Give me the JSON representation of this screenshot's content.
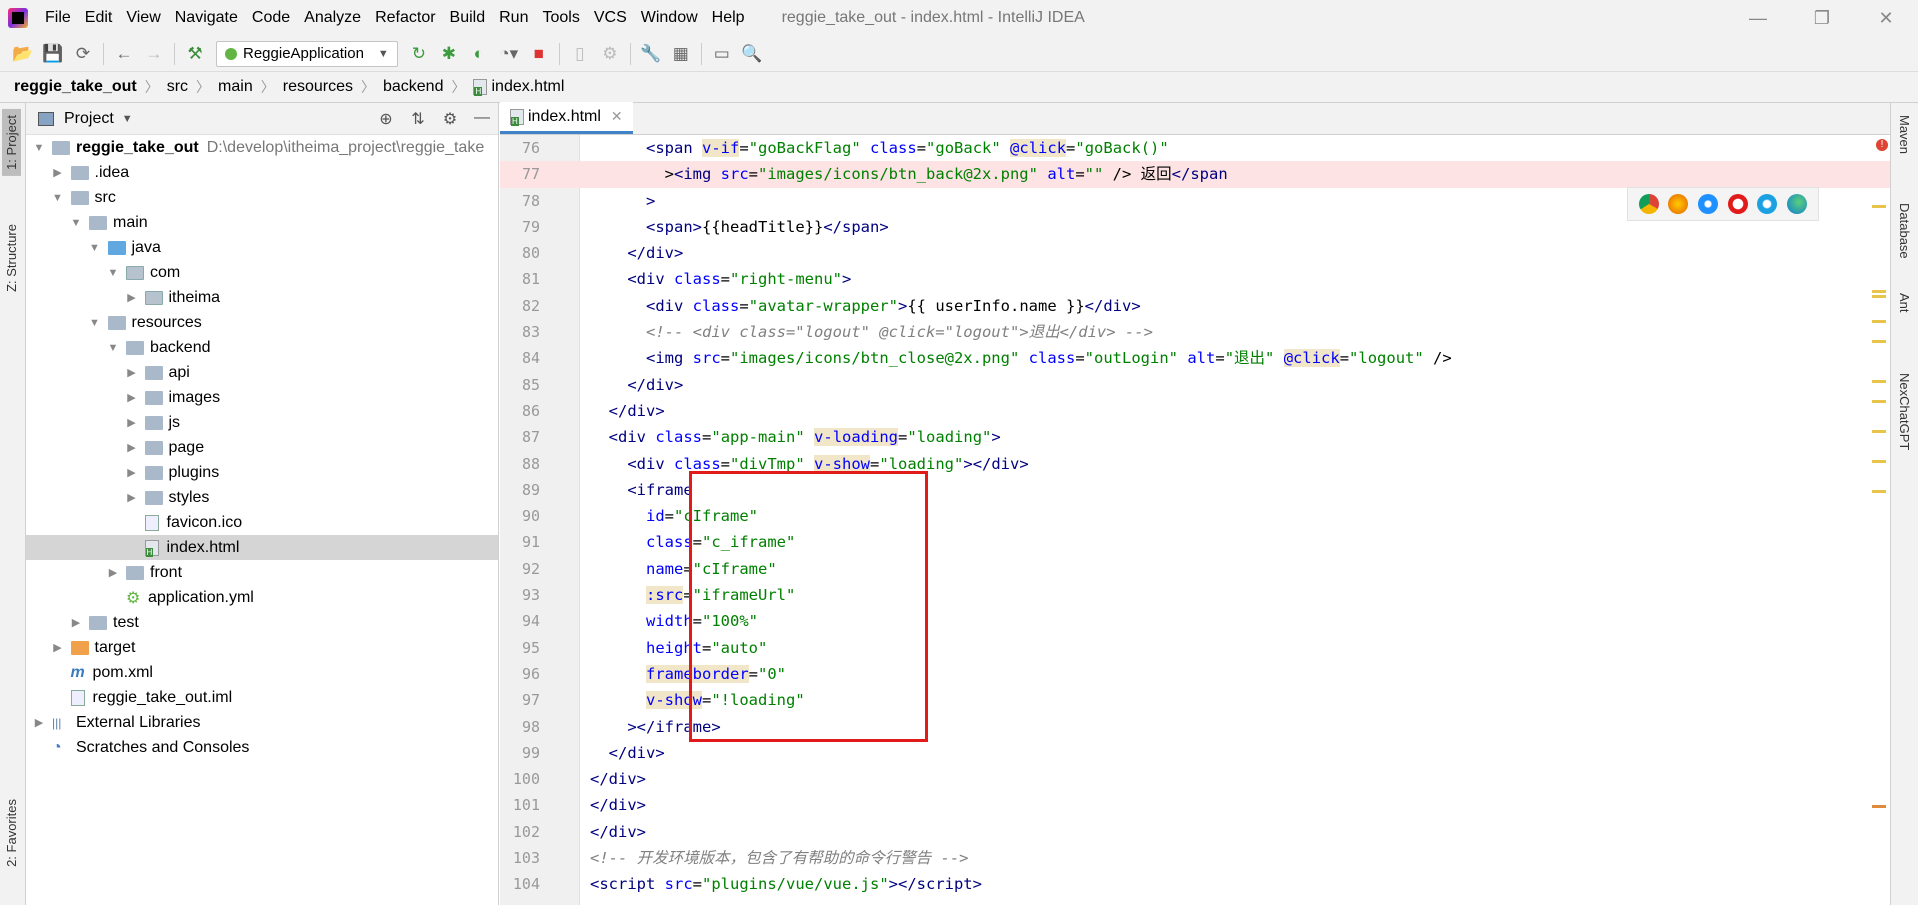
{
  "title_bar": {
    "menu": [
      "File",
      "Edit",
      "View",
      "Navigate",
      "Code",
      "Analyze",
      "Refactor",
      "Build",
      "Run",
      "Tools",
      "VCS",
      "Window",
      "Help"
    ],
    "window_title": "reggie_take_out - index.html - IntelliJ IDEA"
  },
  "toolbar": {
    "run_config": "ReggieApplication"
  },
  "breadcrumb": [
    "reggie_take_out",
    "src",
    "main",
    "resources",
    "backend",
    "index.html"
  ],
  "left_strip": {
    "project": "1: Project",
    "structure": "Z: Structure",
    "favorites": "2: Favorites"
  },
  "project_panel": {
    "title": "Project",
    "tree": [
      {
        "label": "reggie_take_out",
        "path": "D:\\develop\\itheima_project\\reggie_take",
        "level": 0,
        "kind": "module",
        "open": true,
        "bold": true
      },
      {
        "label": ".idea",
        "level": 1,
        "kind": "folder",
        "arrow": "closed"
      },
      {
        "label": "src",
        "level": 1,
        "kind": "folder",
        "arrow": "open"
      },
      {
        "label": "main",
        "level": 2,
        "kind": "folder",
        "arrow": "open"
      },
      {
        "label": "java",
        "level": 3,
        "kind": "folder-blue",
        "arrow": "open"
      },
      {
        "label": "com",
        "level": 4,
        "kind": "package",
        "arrow": "open"
      },
      {
        "label": "itheima",
        "level": 5,
        "kind": "package",
        "arrow": "closed"
      },
      {
        "label": "resources",
        "level": 3,
        "kind": "folder",
        "arrow": "open"
      },
      {
        "label": "backend",
        "level": 4,
        "kind": "folder",
        "arrow": "open"
      },
      {
        "label": "api",
        "level": 5,
        "kind": "folder",
        "arrow": "closed"
      },
      {
        "label": "images",
        "level": 5,
        "kind": "folder",
        "arrow": "closed"
      },
      {
        "label": "js",
        "level": 5,
        "kind": "folder",
        "arrow": "closed"
      },
      {
        "label": "page",
        "level": 5,
        "kind": "folder",
        "arrow": "closed"
      },
      {
        "label": "plugins",
        "level": 5,
        "kind": "folder",
        "arrow": "closed"
      },
      {
        "label": "styles",
        "level": 5,
        "kind": "folder",
        "arrow": "closed"
      },
      {
        "label": "favicon.ico",
        "level": 5,
        "kind": "file",
        "arrow": "none"
      },
      {
        "label": "index.html",
        "level": 5,
        "kind": "html",
        "arrow": "none",
        "selected": true
      },
      {
        "label": "front",
        "level": 4,
        "kind": "folder",
        "arrow": "closed"
      },
      {
        "label": "application.yml",
        "level": 4,
        "kind": "yml",
        "arrow": "none"
      },
      {
        "label": "test",
        "level": 2,
        "kind": "folder",
        "arrow": "closed"
      },
      {
        "label": "target",
        "level": 1,
        "kind": "folder-orange",
        "arrow": "closed"
      },
      {
        "label": "pom.xml",
        "level": 1,
        "kind": "maven",
        "arrow": "none"
      },
      {
        "label": "reggie_take_out.iml",
        "level": 1,
        "kind": "file",
        "arrow": "none"
      },
      {
        "label": "External Libraries",
        "level": 0,
        "kind": "libs",
        "arrow": "closed"
      },
      {
        "label": "Scratches and Consoles",
        "level": 0,
        "kind": "scratch",
        "arrow": "none"
      }
    ]
  },
  "editor": {
    "tab": "index.html",
    "lines": [
      {
        "n": "76",
        "h": "      <span class=\"tag\">&lt;span</span> <span class=\"attr hl\">v-if</span>=<span class=\"val\">\"goBackFlag\"</span> <span class=\"attr\">class</span>=<span class=\"val\">\"goBack\"</span> <span class=\"attr hl\">@click</span>=<span class=\"val\">\"goBack()\"</span>"
      },
      {
        "n": "77",
        "h": "        &gt;<span class=\"tag\">&lt;img</span> <span class=\"attr\">src</span>=<span class=\"val\">\"images/icons/btn_back@2x.png\"</span> <span class=\"attr\">alt</span>=<span class=\"val\">\"\"</span> /&gt; 返回<span class=\"tag\">&lt;/span</span>",
        "err": true
      },
      {
        "n": "78",
        "h": "      <span class=\"tag\">&gt;</span>"
      },
      {
        "n": "79",
        "h": "      <span class=\"tag\">&lt;span&gt;</span>{{headTitle}}<span class=\"tag\">&lt;/span&gt;</span>"
      },
      {
        "n": "80",
        "h": "    <span class=\"tag\">&lt;/div&gt;</span>"
      },
      {
        "n": "81",
        "h": "    <span class=\"tag\">&lt;div</span> <span class=\"attr\">class</span>=<span class=\"val\">\"right-menu\"</span><span class=\"tag\">&gt;</span>"
      },
      {
        "n": "82",
        "h": "      <span class=\"tag\">&lt;div</span> <span class=\"attr\">class</span>=<span class=\"val\">\"avatar-wrapper\"</span><span class=\"tag\">&gt;</span>{{ userInfo.name }}<span class=\"tag\">&lt;/div&gt;</span>"
      },
      {
        "n": "83",
        "h": "      <span class=\"cm\">&lt;!-- &lt;div class=\"logout\" @click=\"logout\"&gt;退出&lt;/div&gt; --&gt;</span>"
      },
      {
        "n": "84",
        "h": "      <span class=\"tag\">&lt;img</span> <span class=\"attr\">src</span>=<span class=\"val\">\"images/icons/btn_close@2x.png\"</span> <span class=\"attr\">class</span>=<span class=\"val\">\"outLogin\"</span> <span class=\"attr\">alt</span>=<span class=\"val\">\"退出\"</span> <span class=\"attr hl\">@click</span>=<span class=\"val\">\"logout\"</span> /&gt;"
      },
      {
        "n": "85",
        "h": "    <span class=\"tag\">&lt;/div&gt;</span>"
      },
      {
        "n": "86",
        "h": "  <span class=\"tag\">&lt;/div&gt;</span>"
      },
      {
        "n": "87",
        "h": "  <span class=\"tag\">&lt;div</span> <span class=\"attr\">class</span>=<span class=\"val\">\"app-main\"</span> <span class=\"attr hl\">v-loading</span>=<span class=\"val\">\"loading\"</span><span class=\"tag\">&gt;</span>"
      },
      {
        "n": "88",
        "h": "    <span class=\"tag\">&lt;div</span> <span class=\"attr\">class</span>=<span class=\"val\">\"divTmp\"</span> <span class=\"attr hl\">v-show</span>=<span class=\"val\">\"loading\"</span><span class=\"tag\">&gt;&lt;/div&gt;</span>"
      },
      {
        "n": "89",
        "h": "    <span class=\"tag\">&lt;iframe</span>"
      },
      {
        "n": "90",
        "h": "      <span class=\"attr\">id</span>=<span class=\"val\">\"cIframe\"</span>"
      },
      {
        "n": "91",
        "h": "      <span class=\"attr\">class</span>=<span class=\"val\">\"c_iframe\"</span>"
      },
      {
        "n": "92",
        "h": "      <span class=\"attr\">name</span>=<span class=\"val\">\"cIframe\"</span>"
      },
      {
        "n": "93",
        "h": "      <span class=\"attr hl\">:src</span>=<span class=\"val\">\"iframeUrl\"</span>"
      },
      {
        "n": "94",
        "h": "      <span class=\"attr\">width</span>=<span class=\"val\">\"100%\"</span>"
      },
      {
        "n": "95",
        "h": "      <span class=\"attr\">height</span>=<span class=\"val\">\"auto\"</span>"
      },
      {
        "n": "96",
        "h": "      <span class=\"attr hl\">frameborder</span>=<span class=\"val\">\"0\"</span>"
      },
      {
        "n": "97",
        "h": "      <span class=\"attr hl\">v-show</span>=<span class=\"val\">\"!loading\"</span>"
      },
      {
        "n": "98",
        "h": "    <span class=\"tag\">&gt;&lt;/iframe&gt;</span>"
      },
      {
        "n": "99",
        "h": "  <span class=\"tag\">&lt;/div&gt;</span>"
      },
      {
        "n": "100",
        "h": "<span class=\"tag\">&lt;/div&gt;</span>"
      },
      {
        "n": "101",
        "h": "<span class=\"tag\">&lt;/div&gt;</span>"
      },
      {
        "n": "102",
        "h": "<span class=\"tag\">&lt;/div&gt;</span>"
      },
      {
        "n": "103",
        "h": "<span class=\"cm\">&lt;!-- 开发环境版本，包含了有帮助的命令行警告 --&gt;</span>"
      },
      {
        "n": "104",
        "h": "<span class=\"tag\">&lt;script</span> <span class=\"attr\">src</span>=<span class=\"val\">\"plugins/vue/vue.js\"</span><span class=\"tag\">&gt;&lt;/script&gt;</span>"
      }
    ]
  },
  "right_strip": [
    "Maven",
    "Database",
    "Ant",
    "NexChatGPT"
  ],
  "browsers": [
    "chrome-icon",
    "firefox-icon",
    "safari-icon",
    "opera-icon",
    "ie-icon",
    "edge-icon"
  ]
}
